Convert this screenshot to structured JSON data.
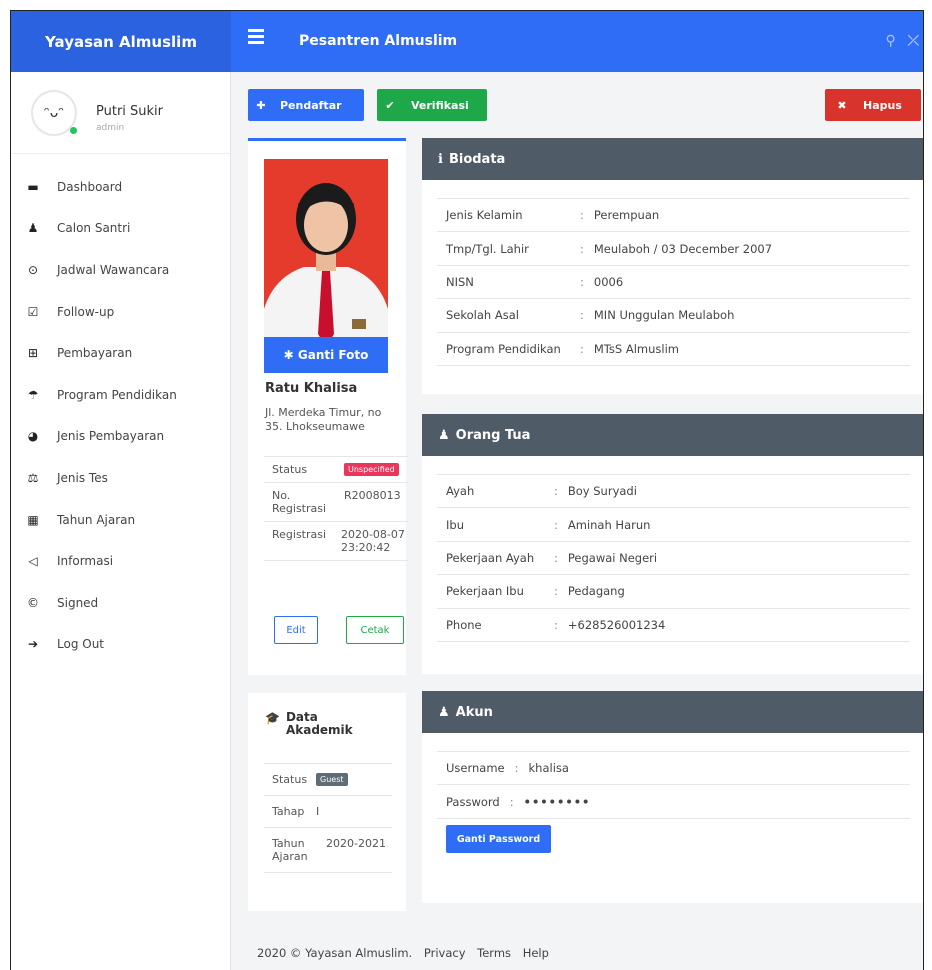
{
  "app": {
    "brand": "Yayasan Almuslim",
    "title": "Pesantren Almuslim"
  },
  "user": {
    "name": "Putri Sukir",
    "role": "admin"
  },
  "sidebar": {
    "items": [
      {
        "label": "Dashboard",
        "icon": "dashboard-icon",
        "glyph": "▬"
      },
      {
        "label": "Calon Santri",
        "icon": "user-icon",
        "glyph": "♟"
      },
      {
        "label": "Jadwal Wawancara",
        "icon": "clock-icon",
        "glyph": "⊙"
      },
      {
        "label": "Follow-up",
        "icon": "check-square-icon",
        "glyph": "☑"
      },
      {
        "label": "Pembayaran",
        "icon": "cart-icon",
        "glyph": "⊞"
      },
      {
        "label": "Program Pendidikan",
        "icon": "umbrella-icon",
        "glyph": "☂"
      },
      {
        "label": "Jenis Pembayaran",
        "icon": "pie-chart-icon",
        "glyph": "◕"
      },
      {
        "label": "Jenis Tes",
        "icon": "balance-scale-icon",
        "glyph": "⚖"
      },
      {
        "label": "Tahun Ajaran",
        "icon": "calendar-icon",
        "glyph": "▦"
      },
      {
        "label": "Informasi",
        "icon": "bullhorn-icon",
        "glyph": "◁"
      },
      {
        "label": "Signed",
        "icon": "copyright-icon",
        "glyph": "©"
      },
      {
        "label": "Log Out",
        "icon": "sign-out-icon",
        "glyph": "➔"
      }
    ]
  },
  "actions": {
    "pendaftar": "Pendaftar",
    "verifikasi": "Verifikasi",
    "hapus": "Hapus"
  },
  "student": {
    "ganti_foto": "✱ Ganti Foto",
    "name": "Ratu Khalisa",
    "address": "Jl. Merdeka Timur, no 35. Lhokseumawe",
    "status_label": "Status",
    "status_value": "Unspecified",
    "noreg_label": "No. Registrasi",
    "noreg_value": "R2008013",
    "reg_label": "Registrasi",
    "reg_value": "2020-08-07 23:20:42",
    "edit": "Edit",
    "cetak": "Cetak"
  },
  "akademik": {
    "title": "Data Akademik",
    "status_label": "Status",
    "status_value": "Guest",
    "tahap_label": "Tahap",
    "tahap_value": "I",
    "tahun_label": "Tahun Ajaran",
    "tahun_value": "2020-2021"
  },
  "biodata": {
    "title": "Biodata",
    "rows": [
      {
        "k": "Jenis Kelamin",
        "v": "Perempuan"
      },
      {
        "k": "Tmp/Tgl. Lahir",
        "v": "Meulaboh / 03 December 2007"
      },
      {
        "k": "NISN",
        "v": "0006"
      },
      {
        "k": "Sekolah Asal",
        "v": "MIN Unggulan Meulaboh"
      },
      {
        "k": "Program Pendidikan",
        "v": "MTsS Almuslim"
      }
    ]
  },
  "orangtua": {
    "title": "Orang Tua",
    "rows": [
      {
        "k": "Ayah",
        "v": "Boy Suryadi"
      },
      {
        "k": "Ibu",
        "v": "Aminah Harun"
      },
      {
        "k": "Pekerjaan Ayah",
        "v": "Pegawai Negeri"
      },
      {
        "k": "Pekerjaan Ibu",
        "v": "Pedagang"
      },
      {
        "k": "Phone",
        "v": "+628526001234"
      }
    ]
  },
  "akun": {
    "title": "Akun",
    "username_label": "Username",
    "username_value": "khalisa",
    "password_label": "Password",
    "password_value": "••••••••",
    "ganti_password": "Ganti Password"
  },
  "footer": {
    "copyright": "2020 © Yayasan Almuslim.",
    "privacy": "Privacy",
    "terms": "Terms",
    "help": "Help"
  },
  "colors": {
    "primary": "#2f6df6",
    "success": "#1fa84a",
    "danger": "#d9342b",
    "card_head": "#4f5b66"
  }
}
